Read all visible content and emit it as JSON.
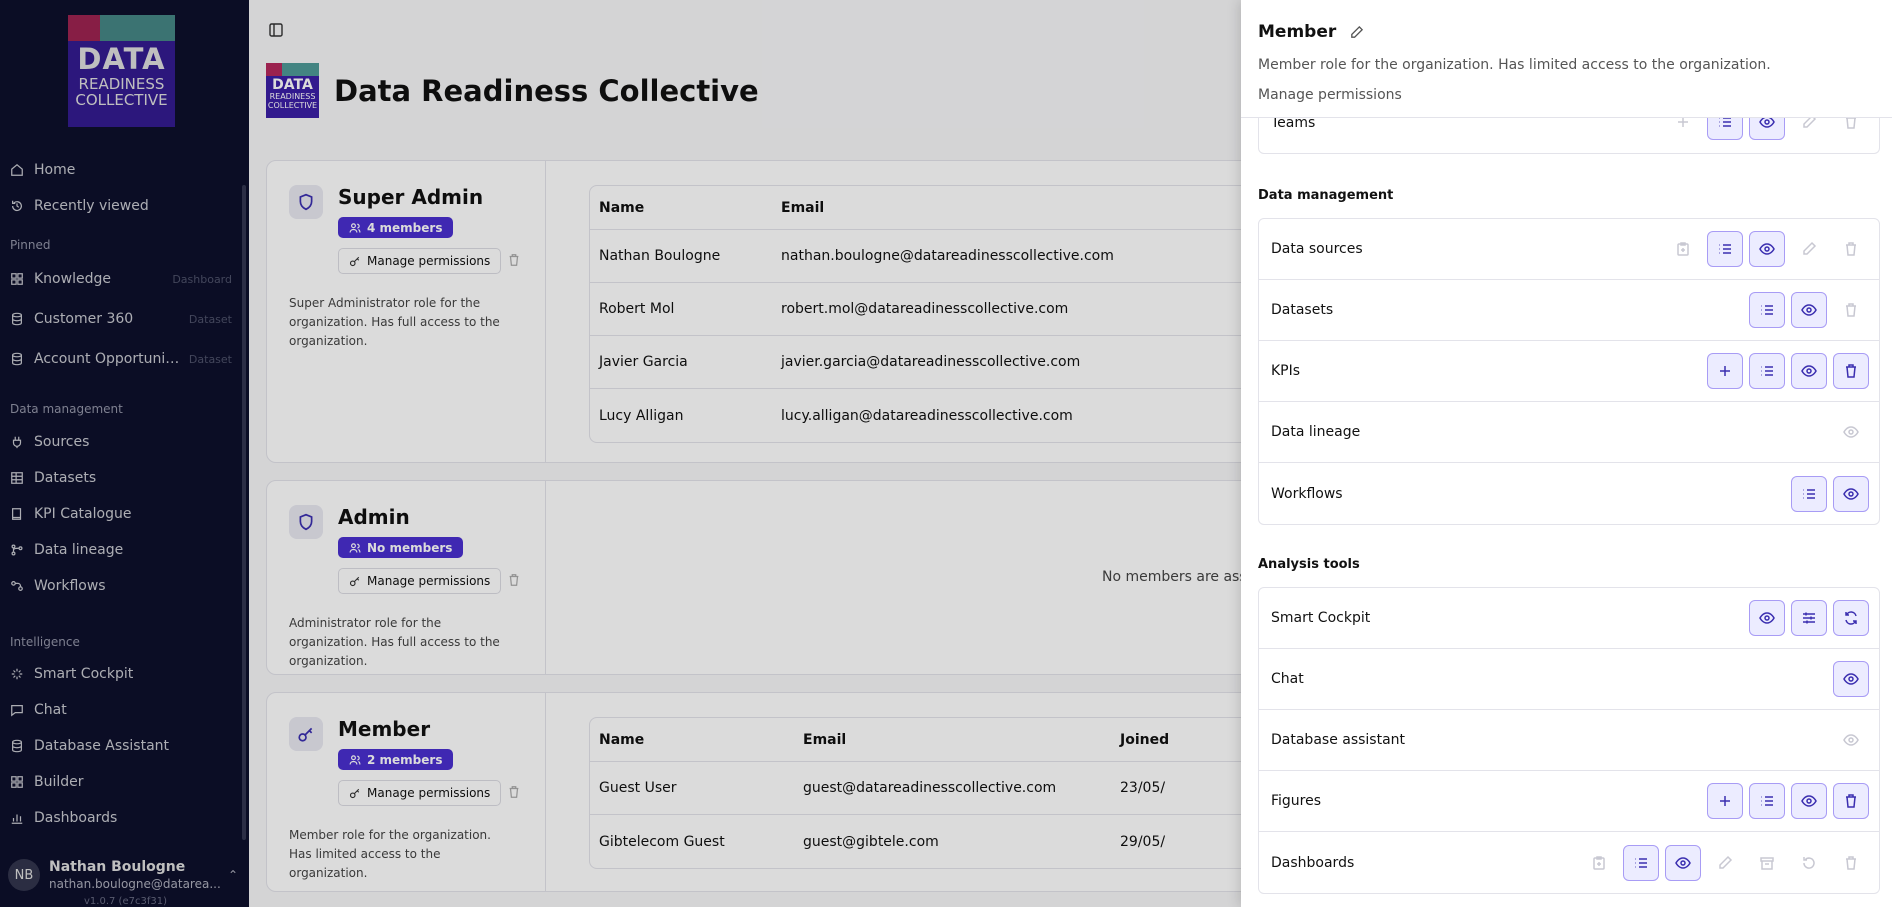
{
  "brand": {
    "line1": "DATA",
    "line2": "READINESS",
    "line3": "COLLECTIVE"
  },
  "sidebar": {
    "top_items": [
      {
        "label": "Home",
        "icon": "home-icon"
      },
      {
        "label": "Recently viewed",
        "icon": "history-icon"
      }
    ],
    "pinned_label": "Pinned",
    "pinned": [
      {
        "label": "Knowledge",
        "tag": "Dashboard",
        "icon": "grid-icon"
      },
      {
        "label": "Customer 360",
        "tag": "Dataset",
        "icon": "database-icon"
      },
      {
        "label": "Account Opportunity ...",
        "tag": "Dataset",
        "icon": "database-icon"
      }
    ],
    "data_label": "Data management",
    "data_items": [
      {
        "label": "Sources",
        "icon": "plug-icon"
      },
      {
        "label": "Datasets",
        "icon": "table-icon"
      },
      {
        "label": "KPI Catalogue",
        "icon": "book-icon"
      },
      {
        "label": "Data lineage",
        "icon": "lineage-icon"
      },
      {
        "label": "Workflows",
        "icon": "workflow-icon"
      }
    ],
    "intel_label": "Intelligence",
    "intel_items": [
      {
        "label": "Smart Cockpit",
        "icon": "sparkle-icon"
      },
      {
        "label": "Chat",
        "icon": "chat-icon"
      },
      {
        "label": "Database Assistant",
        "icon": "database-icon"
      },
      {
        "label": "Builder",
        "icon": "grid-icon"
      },
      {
        "label": "Dashboards",
        "icon": "chart-icon"
      }
    ],
    "user": {
      "initials": "NB",
      "name": "Nathan Boulogne",
      "email": "nathan.boulogne@datarea..."
    },
    "version": "v1.0.7 (e7c3f31)"
  },
  "main": {
    "org_title": "Data Readiness Collective",
    "roles": [
      {
        "name": "Super Admin",
        "badge": "4 members",
        "manage": "Manage permissions",
        "desc": "Super Administrator role for the organization. Has full access to the organization."
      },
      {
        "name": "Admin",
        "badge": "No members",
        "manage": "Manage permissions",
        "desc": "Administrator role for the organization. Has full access to the organization."
      },
      {
        "name": "Member",
        "badge": "2 members",
        "manage": "Manage permissions",
        "desc": "Member role for the organization. Has limited access to the organization."
      }
    ],
    "table_headers": {
      "name": "Name",
      "email": "Email",
      "joined": "Joined"
    },
    "super_admin_members": [
      {
        "name": "Nathan Boulogne",
        "email": "nathan.boulogne@datareadinesscollective.com"
      },
      {
        "name": "Robert Mol",
        "email": "robert.mol@datareadinesscollective.com"
      },
      {
        "name": "Javier Garcia",
        "email": "javier.garcia@datareadinesscollective.com"
      },
      {
        "name": "Lucy Alligan",
        "email": "lucy.alligan@datareadinesscollective.com"
      }
    ],
    "admin_empty": "No members are assig",
    "member_members": [
      {
        "name": "Guest User",
        "email": "guest@datareadinesscollective.com",
        "joined": "23/05/"
      },
      {
        "name": "Gibtelecom Guest",
        "email": "guest@gibtele.com",
        "joined": "29/05/"
      }
    ]
  },
  "panel": {
    "title": "Member",
    "desc": "Member role for the organization. Has limited access to the organization.",
    "sub": "Manage permissions",
    "teams_label": "Teams",
    "data_section": "Data management",
    "data_rows": [
      {
        "label": "Data sources"
      },
      {
        "label": "Datasets"
      },
      {
        "label": "KPIs"
      },
      {
        "label": "Data lineage"
      },
      {
        "label": "Workflows"
      }
    ],
    "analysis_section": "Analysis tools",
    "analysis_rows": [
      {
        "label": "Smart Cockpit"
      },
      {
        "label": "Chat"
      },
      {
        "label": "Database assistant"
      },
      {
        "label": "Figures"
      },
      {
        "label": "Dashboards"
      }
    ]
  },
  "colors": {
    "accent": "#4a2fd0",
    "sidebar_bg": "#0f1232",
    "active_bg": "#ececff"
  }
}
